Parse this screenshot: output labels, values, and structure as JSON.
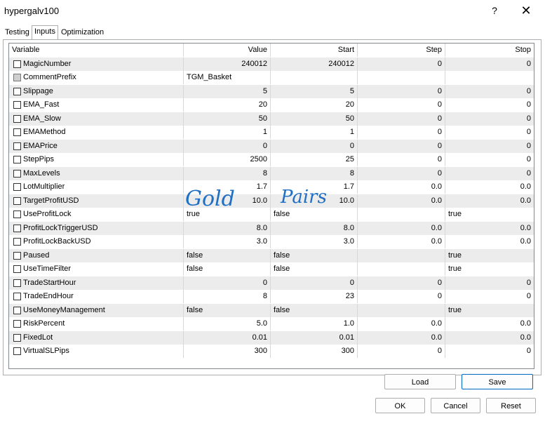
{
  "window": {
    "title": "hypergalv100",
    "help_label": "?",
    "close_label": "✕"
  },
  "tabs": [
    {
      "label": "Testing"
    },
    {
      "label": "Inputs"
    },
    {
      "label": "Optimization"
    }
  ],
  "table": {
    "headers": {
      "variable": "Variable",
      "value": "Value",
      "start": "Start",
      "step": "Step",
      "stop": "Stop"
    },
    "rows": [
      {
        "name": "MagicNumber",
        "value": "240012",
        "start": "240012",
        "step": "0",
        "stop": "0"
      },
      {
        "name": "CommentPrefix",
        "value": "TGM_Basket",
        "start": "",
        "step": "",
        "stop": ""
      },
      {
        "name": "Slippage",
        "value": "5",
        "start": "5",
        "step": "0",
        "stop": "0"
      },
      {
        "name": "EMA_Fast",
        "value": "20",
        "start": "20",
        "step": "0",
        "stop": "0"
      },
      {
        "name": "EMA_Slow",
        "value": "50",
        "start": "50",
        "step": "0",
        "stop": "0"
      },
      {
        "name": "EMAMethod",
        "value": "1",
        "start": "1",
        "step": "0",
        "stop": "0"
      },
      {
        "name": "EMAPrice",
        "value": "0",
        "start": "0",
        "step": "0",
        "stop": "0"
      },
      {
        "name": "StepPips",
        "value": "2500",
        "start": "25",
        "step": "0",
        "stop": "0"
      },
      {
        "name": "MaxLevels",
        "value": "8",
        "start": "8",
        "step": "0",
        "stop": "0"
      },
      {
        "name": "LotMultiplier",
        "value": "1.7",
        "start": "1.7",
        "step": "0.0",
        "stop": "0.0"
      },
      {
        "name": "TargetProfitUSD",
        "value": "10.0",
        "start": "10.0",
        "step": "0.0",
        "stop": "0.0"
      },
      {
        "name": "UseProfitLock",
        "value": "true",
        "start": "false",
        "step": "",
        "stop": "true"
      },
      {
        "name": "ProfitLockTriggerUSD",
        "value": "8.0",
        "start": "8.0",
        "step": "0.0",
        "stop": "0.0"
      },
      {
        "name": "ProfitLockBackUSD",
        "value": "3.0",
        "start": "3.0",
        "step": "0.0",
        "stop": "0.0"
      },
      {
        "name": "Paused",
        "value": "false",
        "start": "false",
        "step": "",
        "stop": "true"
      },
      {
        "name": "UseTimeFilter",
        "value": "false",
        "start": "false",
        "step": "",
        "stop": "true"
      },
      {
        "name": "TradeStartHour",
        "value": "0",
        "start": "0",
        "step": "0",
        "stop": "0"
      },
      {
        "name": "TradeEndHour",
        "value": "8",
        "start": "23",
        "step": "0",
        "stop": "0"
      },
      {
        "name": "UseMoneyManagement",
        "value": "false",
        "start": "false",
        "step": "",
        "stop": "true"
      },
      {
        "name": "RiskPercent",
        "value": "5.0",
        "start": "1.0",
        "step": "0.0",
        "stop": "0.0"
      },
      {
        "name": "FixedLot",
        "value": "0.01",
        "start": "0.01",
        "step": "0.0",
        "stop": "0.0"
      },
      {
        "name": "VirtualSLPips",
        "value": "300",
        "start": "300",
        "step": "0",
        "stop": "0"
      }
    ]
  },
  "annotation": {
    "text_1": "Gold",
    "text_2": "Pairs",
    "color": "#1f6fc2"
  },
  "buttons": {
    "load": "Load",
    "save": "Save",
    "ok": "OK",
    "cancel": "Cancel",
    "reset": "Reset"
  }
}
